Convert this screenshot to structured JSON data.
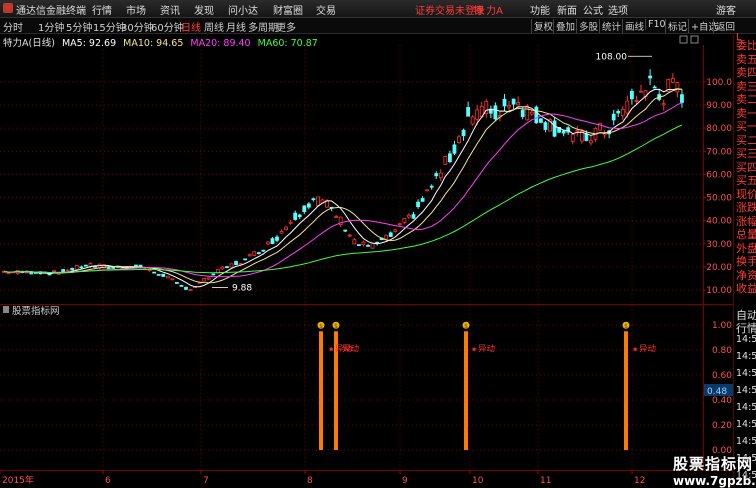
{
  "menu": {
    "app_title": "通达信金融终端",
    "items": [
      "行情",
      "市场",
      "资讯",
      "发现",
      "问小达",
      "财富圈",
      "交易"
    ],
    "notice": "证券交易未登录",
    "stock": "特 力A",
    "right_items": [
      "功能",
      "新面",
      "公式",
      "选项",
      "游客"
    ]
  },
  "toolbar": {
    "periods": [
      "分时",
      "1分钟",
      "5分钟",
      "15分钟",
      "30分钟",
      "60分钟",
      "日线",
      "周线",
      "月线",
      "多周期",
      "更多"
    ],
    "active_period": "日线",
    "right_buttons": [
      "复权",
      "叠加",
      "多股",
      "统计",
      "画线",
      "F10",
      "标记",
      "+自选",
      "返回"
    ]
  },
  "info": {
    "stock_label": "特力A",
    "period_label": "(日线)",
    "ma": [
      {
        "label": "MA5: 92.69",
        "color": "#ffffff"
      },
      {
        "label": "MA10: 94.65",
        "color": "#f0e68c"
      },
      {
        "label": "MA20: 89.40",
        "color": "#ff40ff"
      },
      {
        "label": "MA60: 70.87",
        "color": "#40ff40"
      }
    ]
  },
  "price_axis": [
    "100.0",
    "90.00",
    "80.00",
    "70.00",
    "60.00",
    "50.00",
    "40.00",
    "30.00",
    "20.00",
    "10.00"
  ],
  "price_high_label": "108.00",
  "price_low_label": "9.88",
  "indicator": {
    "label": "股票指标网",
    "axis": [
      "1.00",
      "0.80",
      "0.60",
      "0.40",
      "0.20",
      "0.00"
    ],
    "current_value": "0.48",
    "signal_text": "异动",
    "signals_count": 4
  },
  "time_axis": [
    "2015年",
    "6",
    "7",
    "8",
    "9",
    "10",
    "11",
    "12"
  ],
  "sidebar": {
    "top_mark": "L",
    "items_red": [
      "委比",
      "卖五",
      "卖四",
      "卖三",
      "卖二",
      "卖一",
      "买一",
      "买二",
      "买三",
      "买四",
      "买五",
      "现价",
      "涨跌",
      "涨幅",
      "总量",
      "外盘",
      "换手",
      "净资",
      "收益"
    ],
    "bottom_items": [
      "自动",
      "行情"
    ],
    "times": [
      "14:5",
      "14:5",
      "14:5",
      "14:5",
      "14:5",
      "14:5",
      "14:5",
      "14:5",
      "14:5"
    ]
  },
  "watermark": {
    "line1": "股票指标网",
    "line2": "www.7gpzb.com"
  },
  "colors": {
    "up": "#ff3333",
    "down": "#54ffff",
    "ma5": "#ffffff",
    "ma10": "#f0e68c",
    "ma20": "#ff40ff",
    "ma60": "#40ff40",
    "grid": "#7a0000",
    "signal": "#ff7a00"
  }
}
